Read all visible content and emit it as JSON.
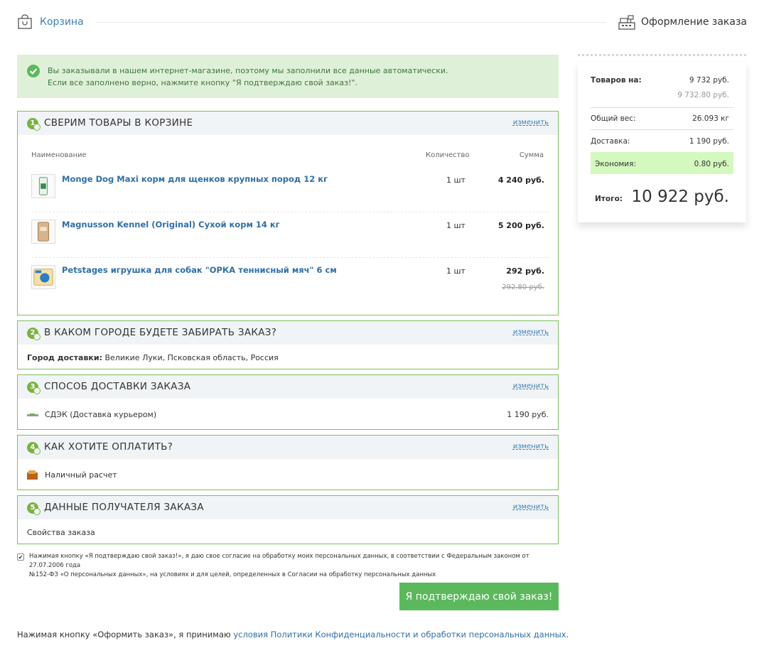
{
  "header": {
    "cart_label": "Корзина",
    "checkout_label": "Оформление заказа"
  },
  "notice": {
    "line1": "Вы заказывали в нашем интернет-магазине, поэтому мы заполнили все данные автоматически.",
    "line2": "Если все заполнено верно, нажмите кнопку \"Я подтверждаю свой заказ!\"."
  },
  "sections": {
    "cart": {
      "num": "1",
      "title": "СВЕРИМ ТОВАРЫ В КОРЗИНЕ",
      "change": "изменить",
      "col_name": "Наименование",
      "col_qty": "Количество",
      "col_sum": "Сумма",
      "items": [
        {
          "name": "Monge Dog Maxi корм для щенков крупных пород 12 кг",
          "qty": "1 шт",
          "sum": "4 240 руб.",
          "old": ""
        },
        {
          "name": "Magnusson Kennel (Original) Сухой корм 14 кг",
          "qty": "1 шт",
          "sum": "5 200 руб.",
          "old": ""
        },
        {
          "name": "Petstages игрушка для собак \"ОРКА теннисный мяч\" 6 см",
          "qty": "1 шт",
          "sum": "292 руб.",
          "old": "292.80 руб."
        }
      ]
    },
    "city": {
      "num": "2",
      "title": "В КАКОМ ГОРОДЕ БУДЕТЕ ЗАБИРАТЬ ЗАКАЗ?",
      "change": "изменить",
      "label": "Город доставки:",
      "value": "Великие Луки, Псковская область, Россия"
    },
    "delivery": {
      "num": "3",
      "title": "СПОСОБ ДОСТАВКИ ЗАКАЗА",
      "change": "изменить",
      "method": "СДЭК (Доставка курьером)",
      "price": "1 190 руб."
    },
    "payment": {
      "num": "4",
      "title": "КАК ХОТИТЕ ОПЛАТИТЬ?",
      "change": "изменить",
      "method": "Наличный расчет"
    },
    "recipient": {
      "num": "5",
      "title": "ДАННЫЕ ПОЛУЧАТЕЛЯ ЗАКАЗА",
      "change": "изменить",
      "props": "Свойства заказа"
    }
  },
  "consent": {
    "checked": true,
    "line1": "Нажимая кнопку «Я подтверждаю свой заказ!», я даю свое согласие на обработку моих персональных данных, в соответствии с Федеральным законом от 27.07.2006 года",
    "line2": "№152-ФЗ «О персональных данных», на условиях и для целей, определенных в Согласии на обработку персональных данных"
  },
  "confirm_button": "Я подтверждаю свой заказ!",
  "footer": {
    "prefix": "Нажимая кнопку «Оформить заказ», я принимаю ",
    "link": "условия Политики Конфиденциальности и обработки персональных данных",
    "suffix": "."
  },
  "summary": {
    "goods_label": "Товаров на:",
    "goods_value": "9 732 руб.",
    "goods_old": "9 732.80 руб.",
    "weight_label": "Общий вес:",
    "weight_value": "26.093 кг",
    "delivery_label": "Доставка:",
    "delivery_value": "1 190 руб.",
    "economy_label": "Экономия:",
    "economy_value": "0.80 руб.",
    "total_label": "Итого:",
    "total_value": "10 922 руб."
  },
  "colors": {
    "accent_green": "#5cb85c",
    "border_green": "#7cc059",
    "link_blue": "#2f6fa7",
    "economy_bg": "#d4f9bf"
  }
}
